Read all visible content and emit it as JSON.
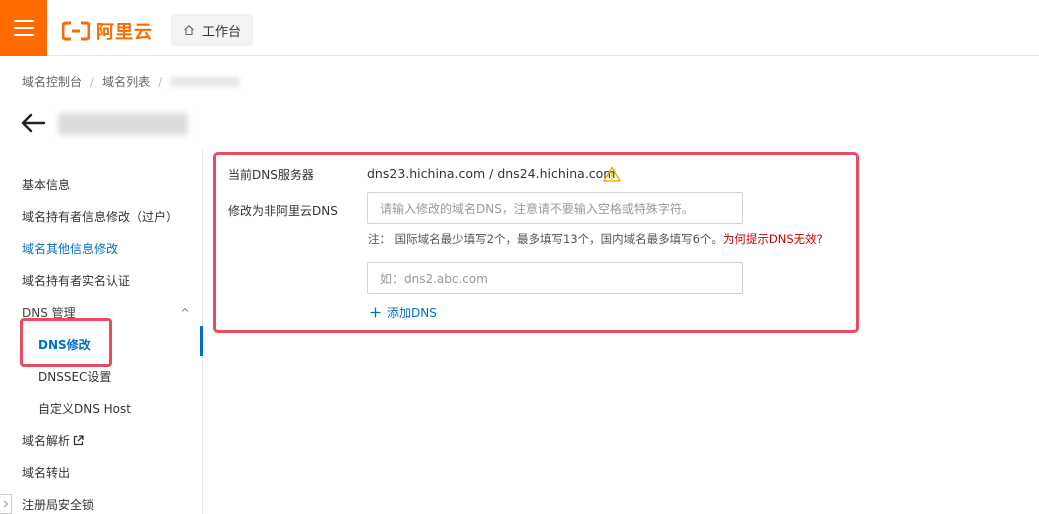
{
  "header": {
    "logo_text": "阿里云",
    "workbench_label": "工作台",
    "brand_color": "#ff6a00"
  },
  "breadcrumb": {
    "items": [
      "域名控制台",
      "域名列表"
    ]
  },
  "nav": {
    "items": [
      {
        "label": "基本信息"
      },
      {
        "label": "域名持有者信息修改（过户）"
      },
      {
        "label": "域名其他信息修改"
      },
      {
        "label": "域名持有者实名认证"
      },
      {
        "label": "DNS 管理"
      },
      {
        "label": "DNS修改"
      },
      {
        "label": "DNSSEC设置"
      },
      {
        "label": "自定义DNS Host"
      },
      {
        "label": "域名解析"
      },
      {
        "label": "域名转出"
      },
      {
        "label": "注册局安全锁"
      }
    ],
    "active_color": "#0070cc"
  },
  "form": {
    "current_dns_label": "当前DNS服务器",
    "current_dns_value": "dns23.hichina.com / dns24.hichina.com",
    "modify_label": "修改为非阿里云DNS",
    "dns_input_placeholder": "请输入修改的域名DNS，注意请不要输入空格或特殊字符。",
    "note_text": "注：  国际域名最少填写2个，最多填写13个，国内域名最多填写6个。",
    "note_link": "为何提示DNS无效?",
    "dns2_placeholder": "如：dns2.abc.com",
    "add_dns_label": "添加DNS",
    "highlight_color": "#e84b62"
  }
}
